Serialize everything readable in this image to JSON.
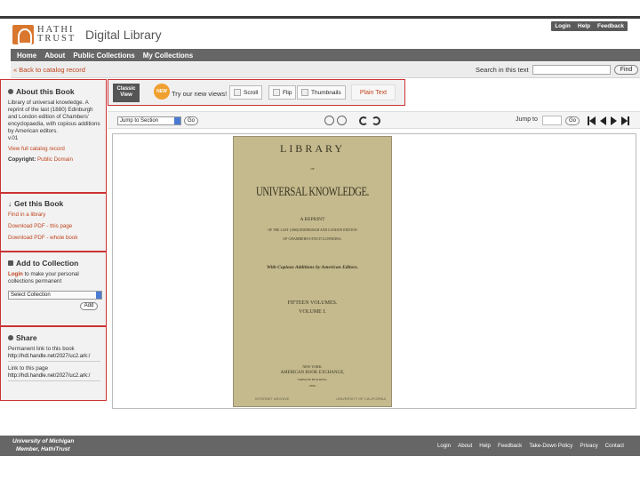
{
  "utility_links": [
    "Login",
    "Help",
    "Feedback"
  ],
  "logo": {
    "line1": "HATHI",
    "line2": "TRUST"
  },
  "site_title": "Digital Library",
  "nav": [
    "Home",
    "About",
    "Public Collections",
    "My Collections"
  ],
  "back_link": "« Back to catalog record",
  "search": {
    "label": "Search in this text",
    "value": "",
    "button": "Find"
  },
  "about": {
    "heading": "About this Book",
    "description": "Library of universal knowledge. A reprint of the last (1880) Edinburgh and London edition of Chambers' encyclopaedia, with copious additions by American editors.",
    "volume": "v.01",
    "catalog_link": "View full catalog record",
    "copyright_label": "Copyright:",
    "copyright_value": "Public Domain"
  },
  "get": {
    "heading": "Get this Book",
    "links": [
      "Find in a library",
      "Download PDF - this page",
      "Download PDF - whole book"
    ]
  },
  "collection": {
    "heading": "Add to Collection",
    "login_link": "Login",
    "login_text": " to make your personal collections permanent",
    "select_value": "Select Collection",
    "add_button": "Add"
  },
  "share": {
    "heading": "Share",
    "permanent_label": "Permanent link to this book",
    "permanent_value": "http://hdl.handle.net/2027/uc2.ark:/",
    "page_label": "Link to this page",
    "page_value": "http://hdl.handle.net/2027/uc2.ark:/"
  },
  "viewtabs": {
    "classic": "Classic View",
    "badge": "NEW",
    "try_text": "Try our new views!",
    "scroll": "Scroll",
    "flip": "Flip",
    "thumbnails": "Thumbnails",
    "plain_text": "Plain Text"
  },
  "toolbar": {
    "jump_section": "Jump to Section",
    "go": "Go",
    "jump_to": "Jump to",
    "go2": "Go"
  },
  "page": {
    "title1": "LIBRARY",
    "of": "OF",
    "title2": "UNIVERSAL KNOWLEDGE.",
    "reprint1": "A REPRINT",
    "reprint2": "OF THE LAST (1880) EDINBURGH AND LONDON EDITION",
    "reprint3": "OF CHAMBERS'S ENCYCLOPAEDIA,",
    "additions": "With Copious Additions by American Editors.",
    "volumes": "FIFTEEN VOLUMES.",
    "volume": "VOLUME I.",
    "pub1": "NEW YORK:",
    "pub2": "AMERICAN BOOK EXCHANGE,",
    "pub3": "TRIBUNE BUILDING.",
    "pub4": "1880.",
    "foot_left": "INTERNET ARCHIVE",
    "foot_right": "UNIVERSITY OF CALIFORNIA"
  },
  "footer": {
    "line1": "University of Michigan",
    "line2": "Member, HathiTrust",
    "links": [
      "Login",
      "About",
      "Help",
      "Feedback",
      "Take-Down Policy",
      "Privacy",
      "Contact"
    ]
  }
}
